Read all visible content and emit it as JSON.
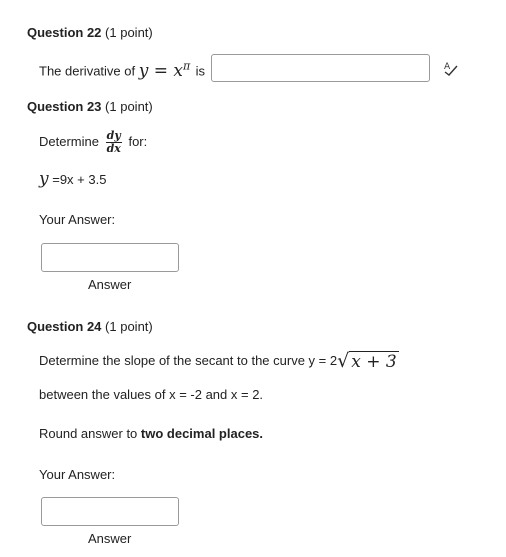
{
  "q22": {
    "title": "Question 22",
    "points": "(1 point)",
    "prefix": "The derivative of",
    "math_y": "y",
    "math_eq": "=",
    "math_x": "x",
    "math_exp": "π",
    "suffix": "is",
    "answer_value": ""
  },
  "q23": {
    "title": "Question 23",
    "points": "(1 point)",
    "determine": "Determine",
    "frac_num": "dy",
    "frac_den": "dx",
    "for": "for:",
    "eq_y": "y",
    "eq_rest": "=9x + 3.5",
    "your_answer": "Your Answer:",
    "answer_value": "",
    "answer_caption": "Answer"
  },
  "q24": {
    "title": "Question 24",
    "points": "(1 point)",
    "line1_prefix": "Determine the slope of the secant to the curve y = 2",
    "radicand": "x + 3",
    "line2": "between the values of x = -2 and x = 2.",
    "round_prefix": "Round answer to",
    "round_bold": "two decimal places.",
    "your_answer": "Your Answer:",
    "answer_value": "",
    "answer_caption": "Answer"
  }
}
